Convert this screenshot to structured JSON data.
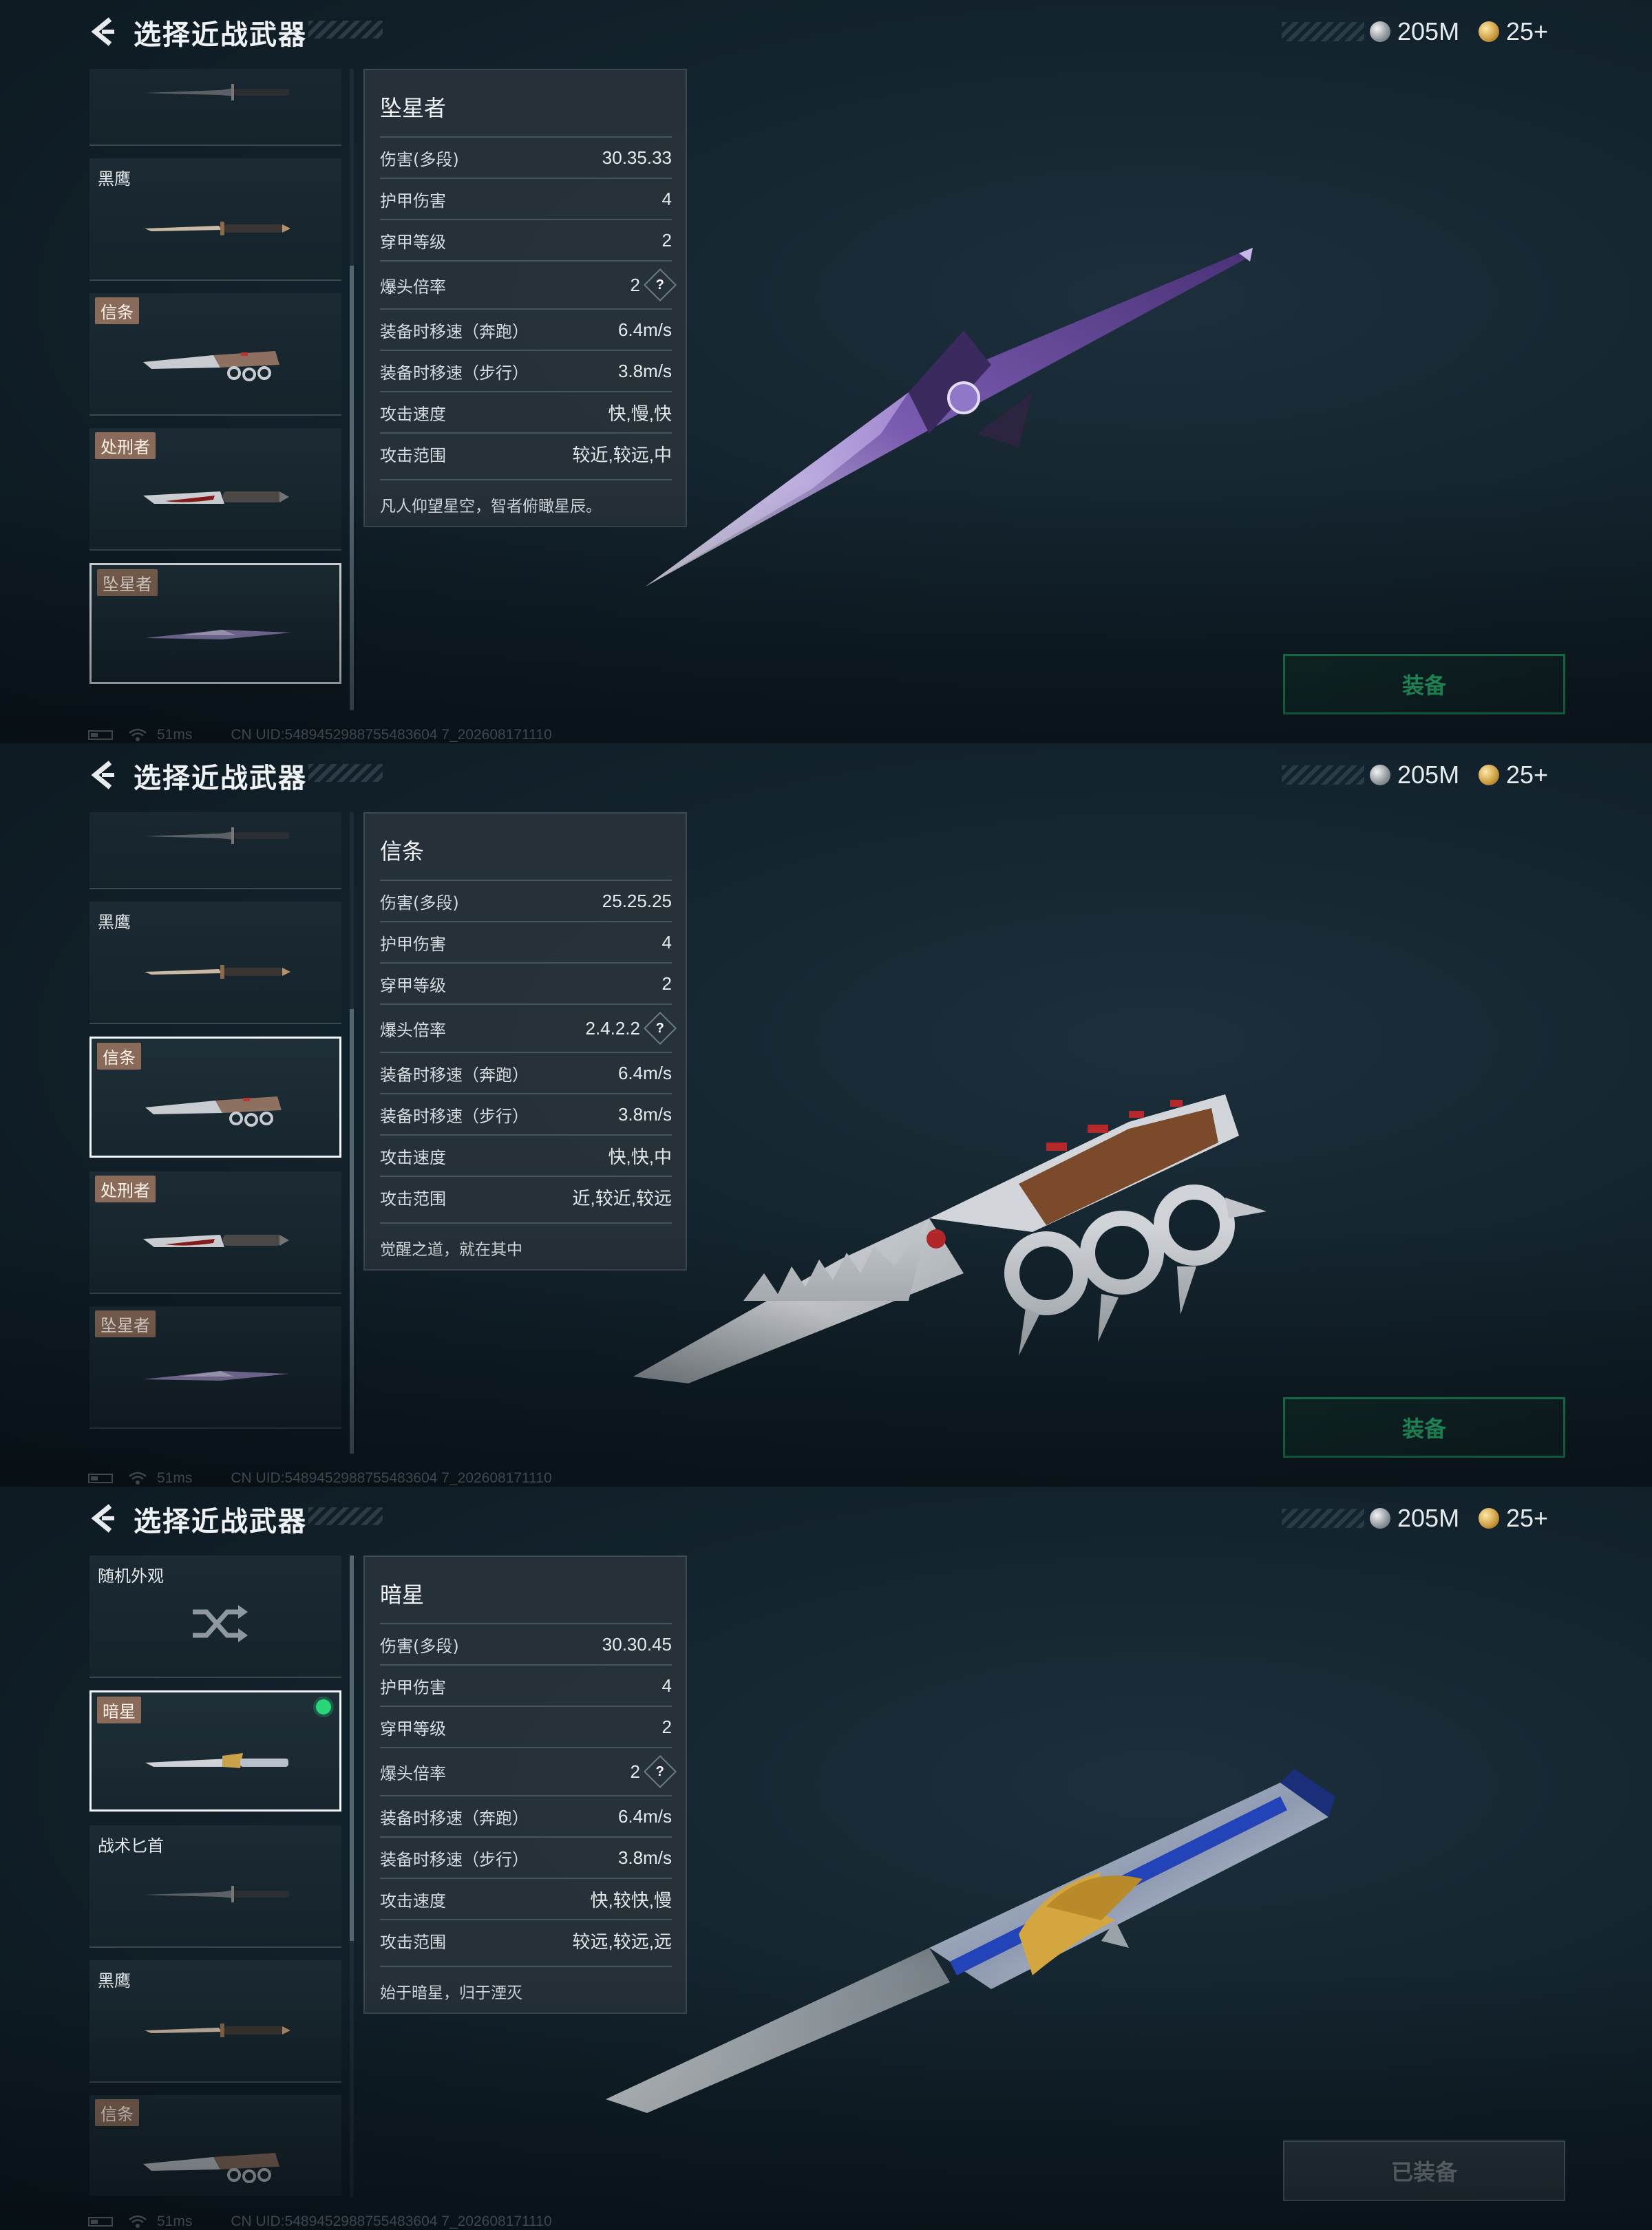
{
  "header": {
    "title": "选择近战武器"
  },
  "currency": {
    "silver": "205M",
    "gold": "25+"
  },
  "footer": {
    "ping": "51ms",
    "uid": "CN UID:5489452988755483604 7_202608171110"
  },
  "panels": [
    {
      "list": [
        {
          "name": "",
          "weapon_icon": "tactical-dagger-icon"
        },
        {
          "name": "黑鹰",
          "tagged": false,
          "weapon_icon": "blackhawk-knife-icon"
        },
        {
          "name": "信条",
          "tagged": true,
          "weapon_icon": "creed-knuckle-knife-icon"
        },
        {
          "name": "处刑者",
          "tagged": true,
          "weapon_icon": "executioner-knife-icon"
        },
        {
          "name": "坠星者",
          "tagged": true,
          "weapon_icon": "starfall-blade-icon",
          "selected": true
        }
      ],
      "card": {
        "name": "坠星者",
        "rows": [
          {
            "label": "伤害(多段)",
            "value": "30.35.33"
          },
          {
            "label": "护甲伤害",
            "value": "4"
          },
          {
            "label": "穿甲等级",
            "value": "2"
          },
          {
            "label": "爆头倍率",
            "value": "2",
            "help": true
          },
          {
            "label": "装备时移速（奔跑）",
            "value": "6.4m/s"
          },
          {
            "label": "装备时移速（步行）",
            "value": "3.8m/s"
          },
          {
            "label": "攻击速度",
            "value": "快,慢,快"
          },
          {
            "label": "攻击范围",
            "value": "较近,较远,中"
          }
        ],
        "desc": "凡人仰望星空，智者俯瞰星辰。"
      },
      "equip_label": "装备",
      "equipped": false
    },
    {
      "list": [
        {
          "name": "",
          "weapon_icon": "tactical-dagger-icon"
        },
        {
          "name": "黑鹰",
          "tagged": false,
          "weapon_icon": "blackhawk-knife-icon"
        },
        {
          "name": "信条",
          "tagged": true,
          "weapon_icon": "creed-knuckle-knife-icon",
          "selected": true
        },
        {
          "name": "处刑者",
          "tagged": true,
          "weapon_icon": "executioner-knife-icon"
        },
        {
          "name": "坠星者",
          "tagged": true,
          "weapon_icon": "starfall-blade-icon"
        }
      ],
      "card": {
        "name": "信条",
        "rows": [
          {
            "label": "伤害(多段)",
            "value": "25.25.25"
          },
          {
            "label": "护甲伤害",
            "value": "4"
          },
          {
            "label": "穿甲等级",
            "value": "2"
          },
          {
            "label": "爆头倍率",
            "value": "2.4.2.2",
            "help": true
          },
          {
            "label": "装备时移速（奔跑）",
            "value": "6.4m/s"
          },
          {
            "label": "装备时移速（步行）",
            "value": "3.8m/s"
          },
          {
            "label": "攻击速度",
            "value": "快,快,中"
          },
          {
            "label": "攻击范围",
            "value": "近,较近,较远"
          }
        ],
        "desc": "觉醒之道，就在其中"
      },
      "equip_label": "装备",
      "equipped": false
    },
    {
      "list": [
        {
          "name": "随机外观",
          "tagged": false,
          "weapon_icon": "shuffle-icon"
        },
        {
          "name": "暗星",
          "tagged": true,
          "weapon_icon": "darkstar-blade-icon",
          "selected": true,
          "equipped": true
        },
        {
          "name": "战术匕首",
          "tagged": false,
          "weapon_icon": "tactical-dagger-icon"
        },
        {
          "name": "黑鹰",
          "tagged": false,
          "weapon_icon": "blackhawk-knife-icon"
        },
        {
          "name": "信条",
          "tagged": true,
          "weapon_icon": "creed-knuckle-knife-icon"
        }
      ],
      "card": {
        "name": "暗星",
        "rows": [
          {
            "label": "伤害(多段)",
            "value": "30.30.45"
          },
          {
            "label": "护甲伤害",
            "value": "4"
          },
          {
            "label": "穿甲等级",
            "value": "2"
          },
          {
            "label": "爆头倍率",
            "value": "2",
            "help": true
          },
          {
            "label": "装备时移速（奔跑）",
            "value": "6.4m/s"
          },
          {
            "label": "装备时移速（步行）",
            "value": "3.8m/s"
          },
          {
            "label": "攻击速度",
            "value": "快,较快,慢"
          },
          {
            "label": "攻击范围",
            "value": "较远,较远,远"
          }
        ],
        "desc": "始于暗星，归于湮灭"
      },
      "equip_label": "已装备",
      "equipped": true
    }
  ],
  "colors": {
    "accent": "#2fd884",
    "tag": "#8a6a58",
    "equipped_dot": "#29d67a"
  }
}
